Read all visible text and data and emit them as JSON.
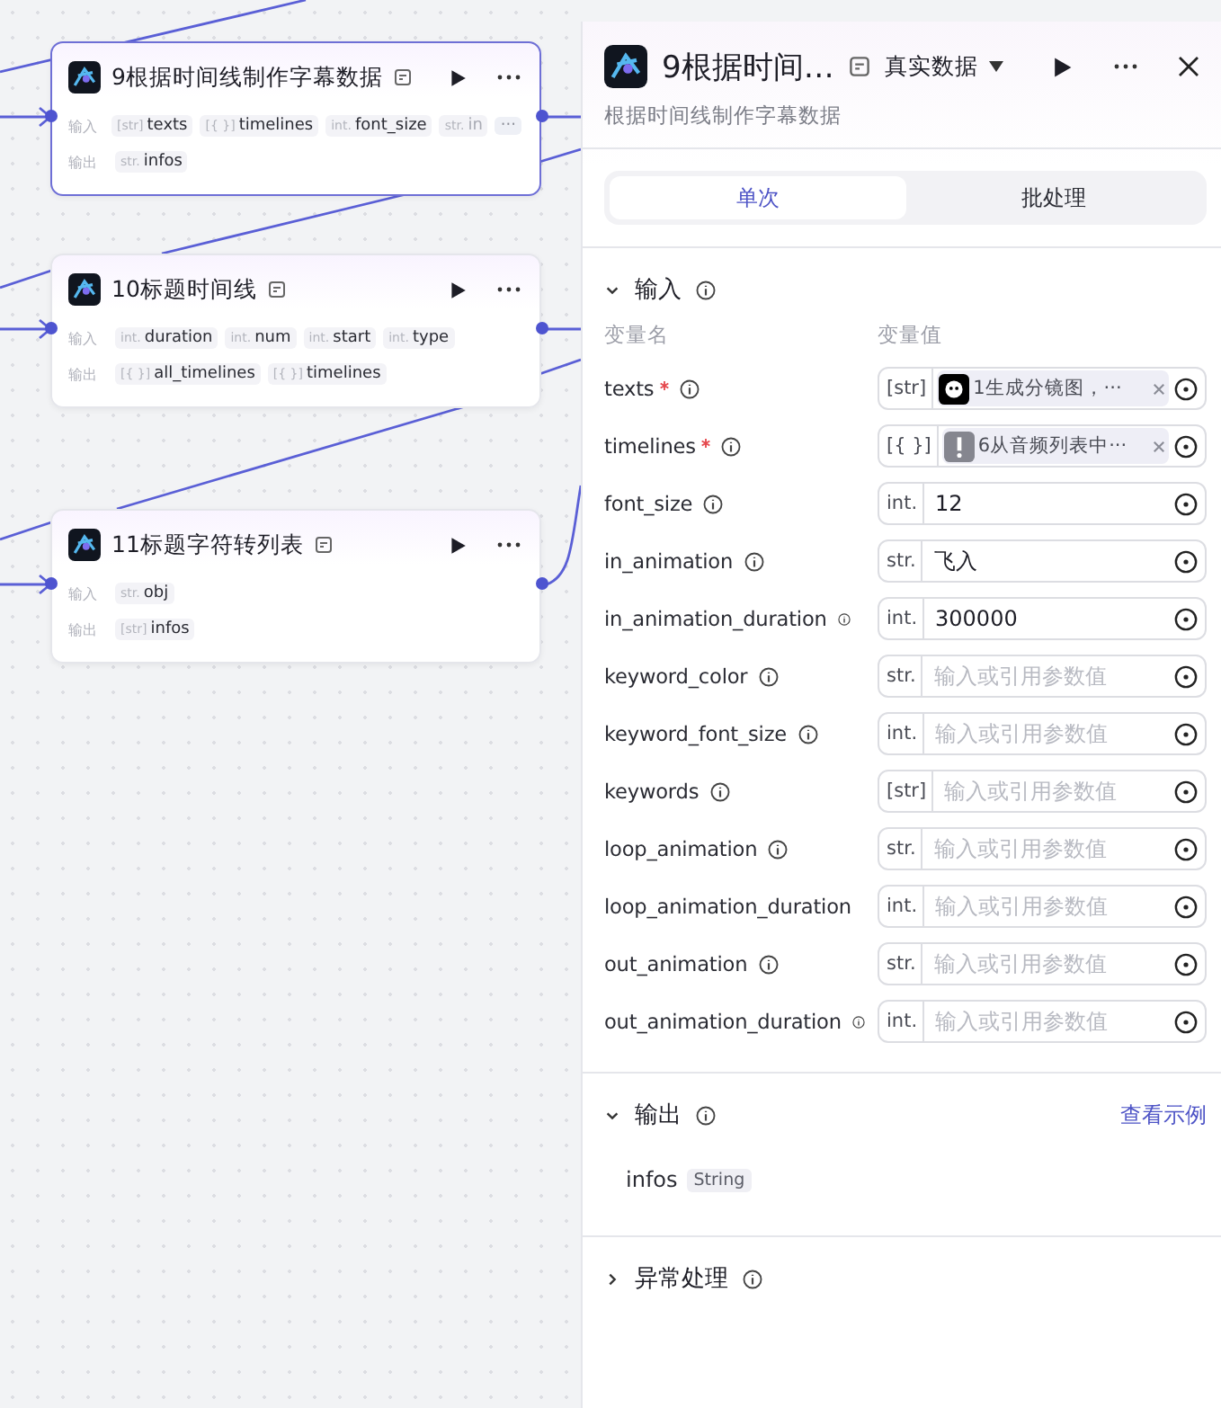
{
  "nodes": [
    {
      "title": "9根据时间线制作字幕数据",
      "selected": true,
      "input_label": "输入",
      "output_label": "输出",
      "inputs": [
        {
          "type": "[str]",
          "name": "texts",
          "faded": false
        },
        {
          "type": "[{ }]",
          "name": "timelines",
          "faded": false
        },
        {
          "type": "int.",
          "name": "font_size",
          "faded": false
        },
        {
          "type": "str.",
          "name": "in",
          "faded": true
        }
      ],
      "more_inputs": "···",
      "outputs": [
        {
          "type": "str.",
          "name": "infos",
          "faded": false
        }
      ]
    },
    {
      "title": "10标题时间线",
      "selected": false,
      "input_label": "输入",
      "output_label": "输出",
      "inputs": [
        {
          "type": "int.",
          "name": "duration",
          "faded": false
        },
        {
          "type": "int.",
          "name": "num",
          "faded": false
        },
        {
          "type": "int.",
          "name": "start",
          "faded": false
        },
        {
          "type": "int.",
          "name": "type",
          "faded": false
        }
      ],
      "outputs": [
        {
          "type": "[{ }]",
          "name": "all_timelines",
          "faded": false
        },
        {
          "type": "[{ }]",
          "name": "timelines",
          "faded": false
        }
      ]
    },
    {
      "title": "11标题字符转列表",
      "selected": false,
      "input_label": "输入",
      "output_label": "输出",
      "inputs": [
        {
          "type": "str.",
          "name": "obj",
          "faded": false
        }
      ],
      "outputs": [
        {
          "type": "[str]",
          "name": "infos",
          "faded": false
        }
      ]
    }
  ],
  "panel": {
    "title": "9根据时间…",
    "data_mode": "真实数据",
    "description": "根据时间线制作字幕数据",
    "tabs": [
      {
        "label": "单次",
        "selected": true
      },
      {
        "label": "批处理",
        "selected": false
      }
    ],
    "input_section": {
      "title": "输入",
      "expanded": true,
      "col_name": "变量名",
      "col_value": "变量值",
      "rows": [
        {
          "name": "texts",
          "required": true,
          "info": true,
          "type": "[str]",
          "kind": "ref",
          "ref": {
            "kind": "bot",
            "text": "1生成分镜图，···"
          }
        },
        {
          "name": "timelines",
          "required": true,
          "info": true,
          "type": "[{ }]",
          "kind": "ref",
          "ref": {
            "kind": "alert",
            "text": "6从音频列表中···"
          }
        },
        {
          "name": "font_size",
          "required": false,
          "info": true,
          "type": "int.",
          "kind": "value",
          "value": "12"
        },
        {
          "name": "in_animation",
          "required": false,
          "info": true,
          "type": "str.",
          "kind": "value",
          "value": "飞入"
        },
        {
          "name": "in_animation_duration",
          "required": false,
          "info": true,
          "type": "int.",
          "kind": "value",
          "value": "300000"
        },
        {
          "name": "keyword_color",
          "required": false,
          "info": true,
          "type": "str.",
          "kind": "empty",
          "placeholder": "输入或引用参数值"
        },
        {
          "name": "keyword_font_size",
          "required": false,
          "info": true,
          "type": "int.",
          "kind": "empty",
          "placeholder": "输入或引用参数值"
        },
        {
          "name": "keywords",
          "required": false,
          "info": true,
          "type": "[str]",
          "kind": "empty",
          "placeholder": "输入或引用参数值"
        },
        {
          "name": "loop_animation",
          "required": false,
          "info": true,
          "type": "str.",
          "kind": "empty",
          "placeholder": "输入或引用参数值"
        },
        {
          "name": "loop_animation_duration",
          "required": false,
          "info": false,
          "type": "int.",
          "kind": "empty",
          "placeholder": "输入或引用参数值"
        },
        {
          "name": "out_animation",
          "required": false,
          "info": true,
          "type": "str.",
          "kind": "empty",
          "placeholder": "输入或引用参数值"
        },
        {
          "name": "out_animation_duration",
          "required": false,
          "info": true,
          "type": "int.",
          "kind": "empty",
          "placeholder": "输入或引用参数值"
        }
      ]
    },
    "output_section": {
      "title": "输出",
      "expanded": true,
      "link": "查看示例",
      "outputs": [
        {
          "name": "infos",
          "type": "String"
        }
      ]
    },
    "error_section": {
      "title": "异常处理",
      "expanded": false
    }
  }
}
